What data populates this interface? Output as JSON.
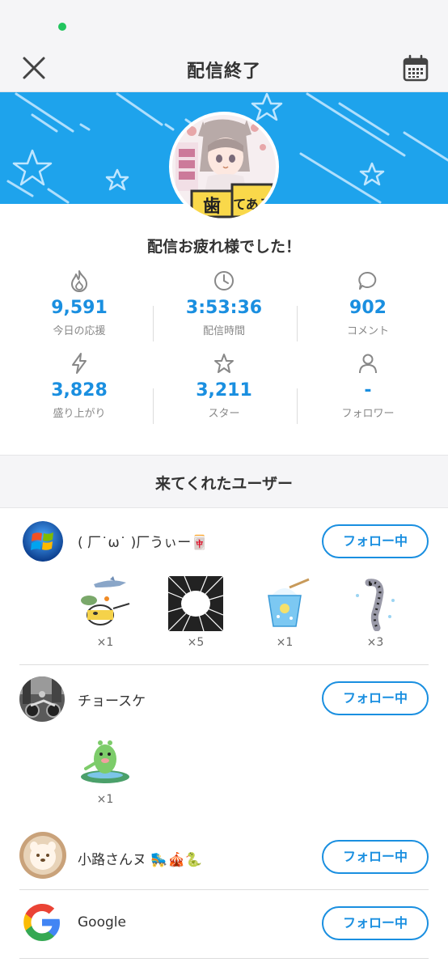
{
  "header": {
    "title": "配信終了"
  },
  "thanks_text": "配信お疲れ様でした！",
  "stats": [
    {
      "icon": "flame-icon",
      "value": "9,591",
      "label": "今日の応援"
    },
    {
      "icon": "clock-icon",
      "value": "3:53:36",
      "label": "配信時間"
    },
    {
      "icon": "comment-icon",
      "value": "902",
      "label": "コメント"
    },
    {
      "icon": "lightning-icon",
      "value": "3,828",
      "label": "盛り上がり"
    },
    {
      "icon": "star-icon",
      "value": "3,211",
      "label": "スター"
    },
    {
      "icon": "person-icon",
      "value": "-",
      "label": "フォロワー"
    }
  ],
  "section_title": "来てくれたユーザー",
  "users": [
    {
      "name": "( 厂˙ω˙ )厂うぃー🀄️",
      "follow_label": "フォロー中",
      "gifts": [
        {
          "icon": "shark-turtle-pot-gift-icon",
          "count": "×1"
        },
        {
          "icon": "speed-lines-gift-icon",
          "count": "×5"
        },
        {
          "icon": "shaved-ice-gift-icon",
          "count": "×1"
        },
        {
          "icon": "garden-eel-gift-icon",
          "count": "×3"
        }
      ]
    },
    {
      "name": "チョースケ",
      "follow_label": "フォロー中",
      "gifts": [
        {
          "icon": "dino-ufo-gift-icon",
          "count": "×1"
        }
      ]
    },
    {
      "name": "小路さんヌ 🛼🎪🐍",
      "follow_label": "フォロー中",
      "gifts": []
    },
    {
      "name": "Google",
      "follow_label": "フォロー中",
      "gifts": []
    }
  ],
  "colors": {
    "accent": "#1a8fe0",
    "banner": "#1ea3ec",
    "status_dot": "#22c55e"
  }
}
